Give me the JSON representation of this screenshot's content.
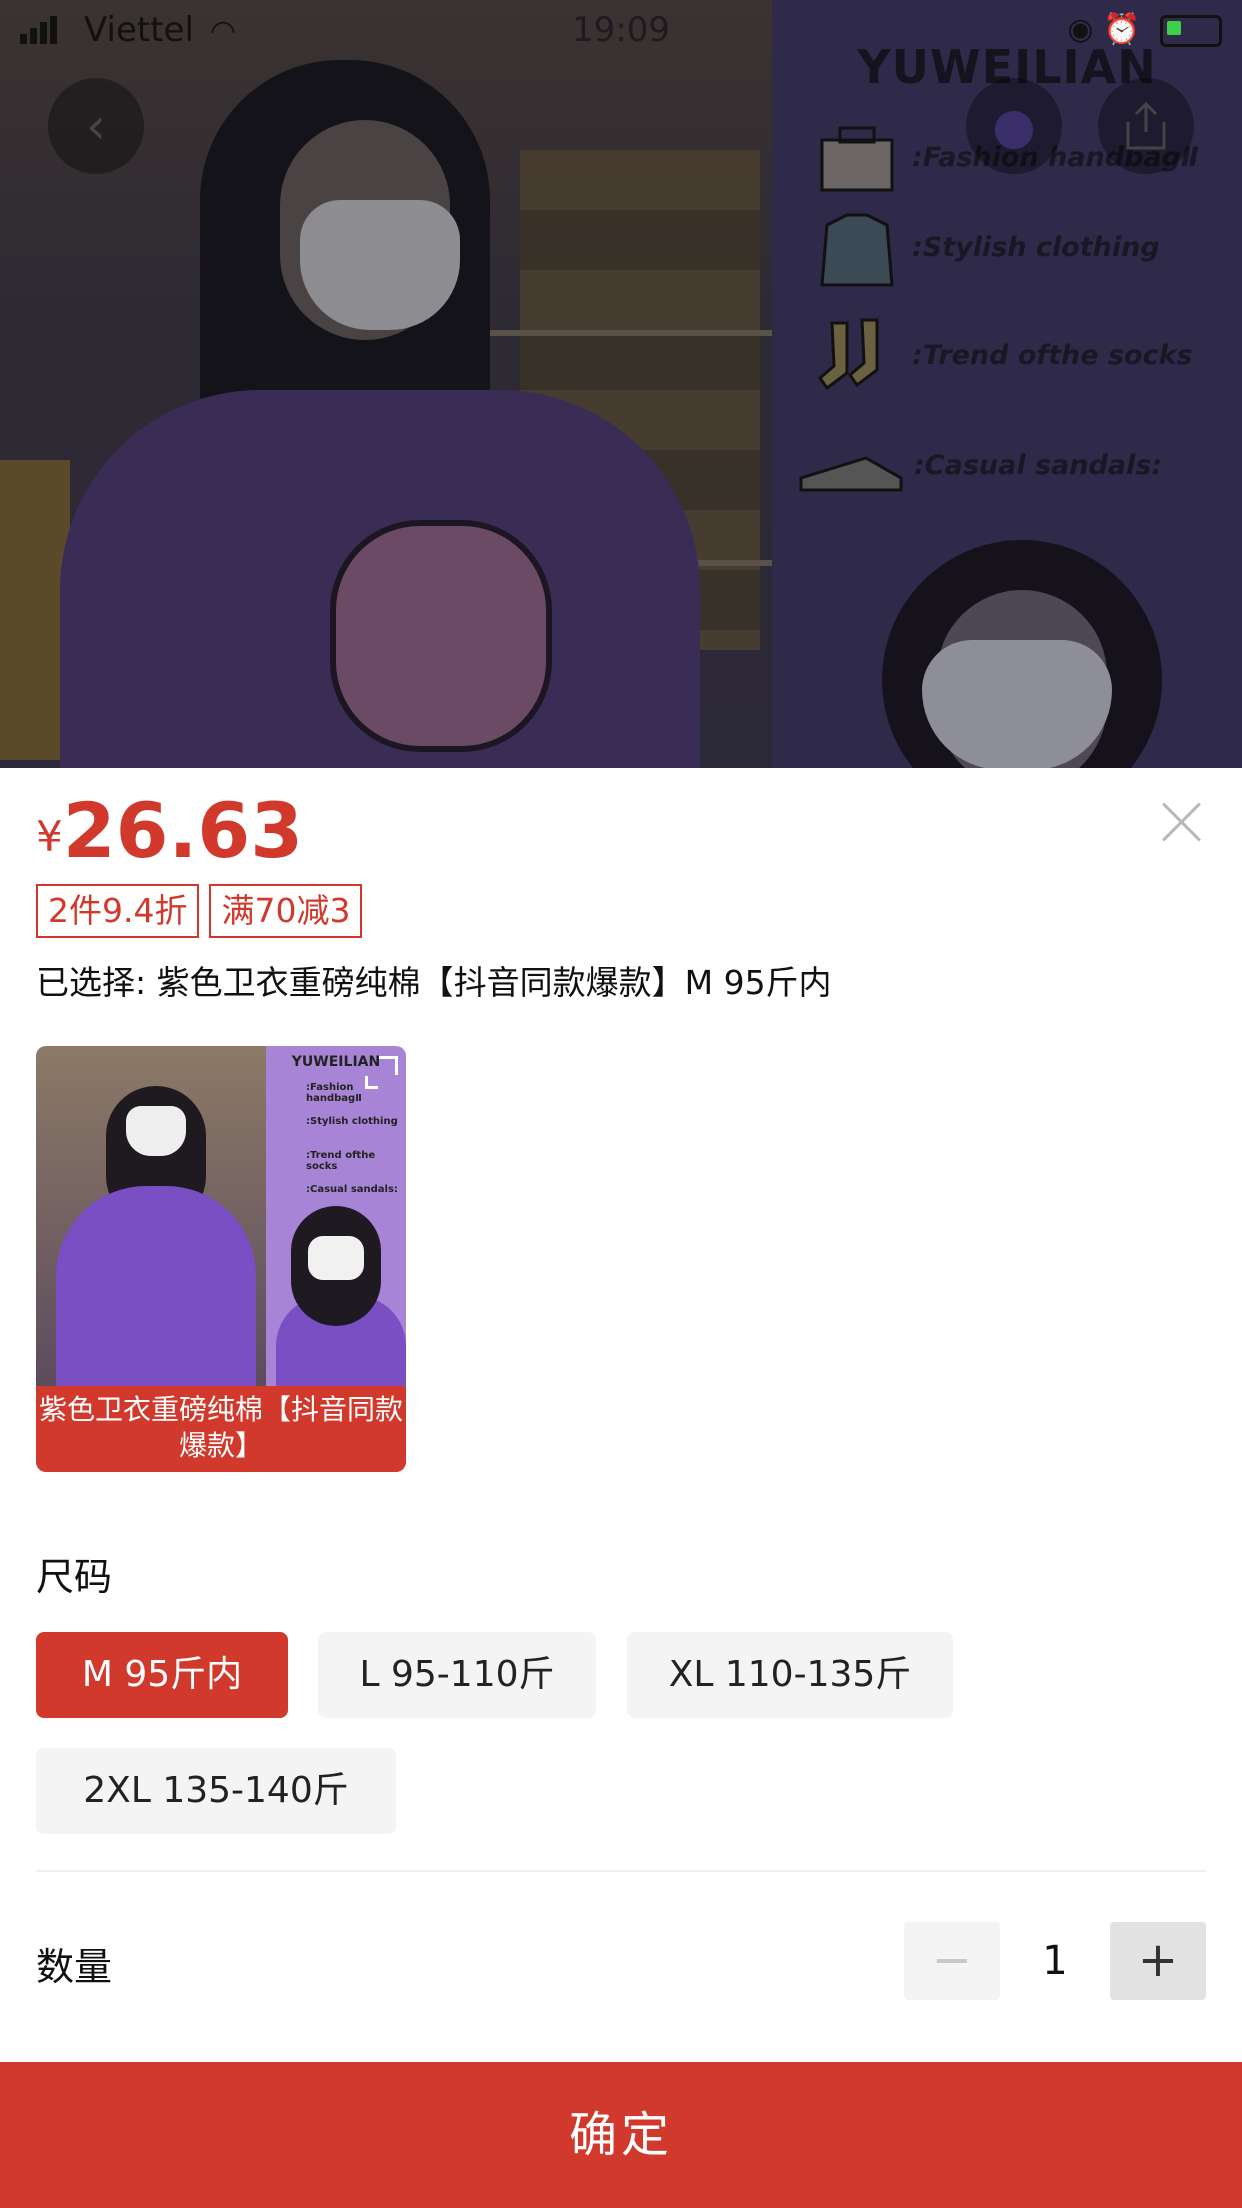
{
  "status_bar": {
    "carrier": "Viettel",
    "time": "19:09"
  },
  "background": {
    "brand": "YUWEILIAN",
    "features": [
      ":Fashion handbagⅡ",
      ":Stylish clothing",
      ":Trend ofthe socks",
      ":Casual sandals:"
    ]
  },
  "sheet": {
    "currency": "¥",
    "price": "26.63",
    "promos": [
      "2件9.4折",
      "满70减3"
    ],
    "selected_text": "已选择: 紫色卫衣重磅纯棉【抖音同款爆款】M 95斤内",
    "variant": {
      "caption": "紫色卫衣重磅纯棉【抖音同款爆款】",
      "thumb_brand": "YUWEILIAN",
      "thumb_lines": [
        ":Fashion handbagⅡ",
        ":Stylish clothing",
        ":Trend ofthe socks",
        ":Casual sandals:"
      ]
    },
    "size_label": "尺码",
    "sizes": [
      "M 95斤内",
      "L 95-110斤",
      "XL 110-135斤",
      "2XL 135-140斤"
    ],
    "quantity_label": "数量",
    "quantity": "1",
    "minus": "−",
    "plus": "+",
    "confirm": "确定"
  }
}
